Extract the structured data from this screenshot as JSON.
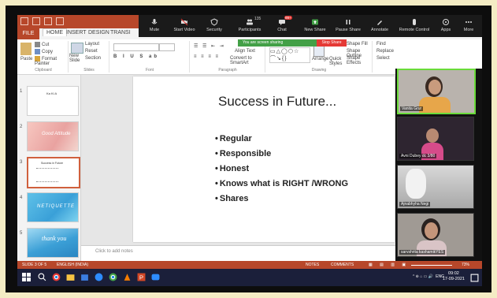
{
  "ppt": {
    "tabs": [
      "FILE",
      "HOME",
      "INSERT",
      "DESIGN",
      "TRANSI"
    ],
    "active_tab": "HOME",
    "ribbon": {
      "clipboard": {
        "paste": "Paste",
        "cut": "Cut",
        "copy": "Copy",
        "format_painter": "Format Painter",
        "label": "Clipboard"
      },
      "slides": {
        "new_slide": "New Slide",
        "layout": "Layout",
        "reset": "Reset",
        "section": "Section",
        "label": "Slides"
      },
      "font_label": "Font",
      "paragraph": {
        "align_text": "Align Text",
        "convert": "Convert to SmartArt",
        "label": "Paragraph"
      },
      "drawing": {
        "arrange": "Arrange",
        "quick_styles": "Quick Styles",
        "shape_fill": "Shape Fill",
        "shape_outline": "Shape Outline",
        "shape_effects": "Shape Effects",
        "label": "Drawing"
      },
      "editing": {
        "find": "Find",
        "replace": "Replace",
        "select": "Select"
      }
    },
    "sharing_banner": "You are screen sharing",
    "stop_share": "Stop Share",
    "slide": {
      "title": "Success in Future...",
      "bullets": [
        "Regular",
        "Responsible",
        "Honest",
        "Knows what is RIGHT /WRONG",
        "Shares"
      ]
    },
    "thumb_numbers": [
      "1",
      "2",
      "3",
      "4",
      "5"
    ],
    "thumb_text": [
      "Ka Ki A",
      "Good Attitude",
      "Success in Future",
      "NETIQUETTE",
      "thank you"
    ],
    "notes_placeholder": "Click to add notes",
    "statusbar": {
      "slide": "SLIDE 3 OF 5",
      "lang": "ENGLISH (INDIA)",
      "notes": "NOTES",
      "comments": "COMMENTS",
      "zoom": "73%"
    }
  },
  "zoom": {
    "buttons": [
      "Mute",
      "Start Video",
      "Security",
      "Participants",
      "Chat",
      "New Share",
      "Pause Share",
      "Annotate",
      "Remote Control",
      "Apps",
      "More"
    ],
    "participants_count": "135",
    "chat_badge": "99+",
    "participants": [
      {
        "name": "Vanita Grur"
      },
      {
        "name": "Avni Dubey dc 3/80"
      },
      {
        "name": "Ajnabhyha Negi"
      },
      {
        "name": "sarvshrita kashamikYES"
      }
    ]
  },
  "taskbar": {
    "time": "09:02",
    "date": "17-09-2021",
    "lang": "ENG",
    "tray": "^ ⊕ ⌂ ▭ 🔊"
  }
}
